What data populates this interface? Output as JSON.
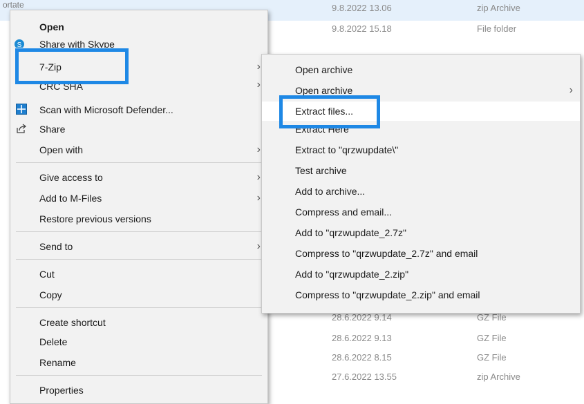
{
  "background": {
    "top_fragment": "ortate",
    "rows": [
      {
        "date": "9.8.2022 13.06",
        "type": "zip Archive"
      },
      {
        "date": "9.8.2022 15.18",
        "type": "File folder"
      },
      {
        "date": "28.6.2022 9.14",
        "type": "GZ File"
      },
      {
        "date": "28.6.2022 9.13",
        "type": "GZ File"
      },
      {
        "date": "28.6.2022 8.15",
        "type": "GZ File"
      },
      {
        "date": "27.6.2022 13.55",
        "type": "zip Archive"
      }
    ]
  },
  "main_menu": {
    "items": [
      {
        "label": "Open",
        "bold": true
      },
      {
        "label": "Share with Skype",
        "icon": "skype-icon"
      },
      {
        "label": "7-Zip",
        "submenu": true
      },
      {
        "label": "CRC SHA",
        "submenu": true
      },
      {
        "label": "Scan with Microsoft Defender...",
        "icon": "defender-icon"
      },
      {
        "label": "Share",
        "icon": "share-icon"
      },
      {
        "label": "Open with",
        "submenu": true
      },
      {
        "label": "Give access to",
        "submenu": true
      },
      {
        "label": "Add to M-Files",
        "submenu": true
      },
      {
        "label": "Restore previous versions"
      },
      {
        "label": "Send to",
        "submenu": true
      },
      {
        "label": "Cut"
      },
      {
        "label": "Copy"
      },
      {
        "label": "Create shortcut"
      },
      {
        "label": "Delete"
      },
      {
        "label": "Rename"
      },
      {
        "label": "Properties"
      }
    ]
  },
  "zip_menu": {
    "items": [
      {
        "label": "Open archive"
      },
      {
        "label": "Open archive",
        "submenu": true
      },
      {
        "label": "Extract files..."
      },
      {
        "label": "Extract Here"
      },
      {
        "label": "Extract to \"qrzwupdate\\\""
      },
      {
        "label": "Test archive"
      },
      {
        "label": "Add to archive..."
      },
      {
        "label": "Compress and email..."
      },
      {
        "label": "Add to \"qrzwupdate_2.7z\""
      },
      {
        "label": "Compress to \"qrzwupdate_2.7z\" and email"
      },
      {
        "label": "Add to \"qrzwupdate_2.zip\""
      },
      {
        "label": "Compress to \"qrzwupdate_2.zip\" and email"
      }
    ]
  },
  "arrow_glyph": "›",
  "highlight_color": "#1e88e5"
}
